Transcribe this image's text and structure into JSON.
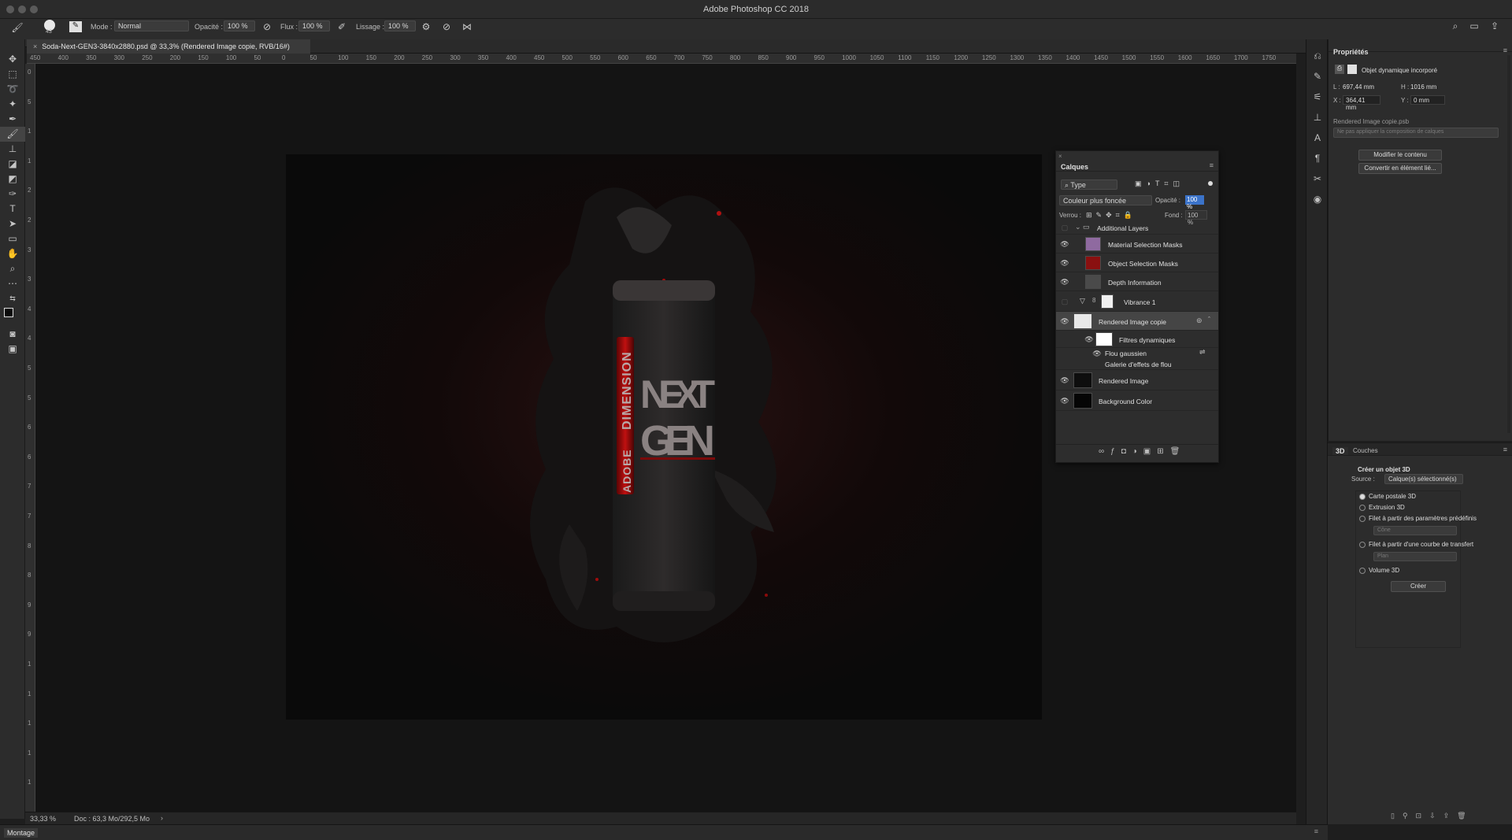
{
  "app": {
    "title": "Adobe Photoshop CC 2018"
  },
  "options_bar": {
    "brush_size": "43",
    "mode_label": "Mode :",
    "mode_value": "Normal",
    "opacity_label": "Opacité :",
    "opacity_value": "100 %",
    "flow_label": "Flux :",
    "flow_value": "100 %",
    "smoothing_label": "Lissage :",
    "smoothing_value": "100 %"
  },
  "document": {
    "tab_title": "Soda-Next-GEN3-3840x2880.psd @ 33,3% (Rendered Image copie, RVB/16#)",
    "zoom": "33,33 %",
    "doc_info": "Doc : 63,3 Mo/292,5 Mo"
  },
  "rulers": {
    "h_ticks": [
      "450",
      "400",
      "350",
      "300",
      "250",
      "200",
      "150",
      "100",
      "50",
      "0",
      "50",
      "100",
      "150",
      "200",
      "250",
      "300",
      "350",
      "400",
      "450",
      "500",
      "550",
      "600",
      "650",
      "700",
      "750",
      "800",
      "850",
      "900",
      "950",
      "1000",
      "1050",
      "1100",
      "1150",
      "1200",
      "1250",
      "1300",
      "1350",
      "1400",
      "1450",
      "1500",
      "1550",
      "1600",
      "1650",
      "1700",
      "1750"
    ],
    "v_ticks": [
      "0",
      "5",
      "1",
      "1",
      "2",
      "2",
      "3",
      "3",
      "4",
      "4",
      "5",
      "5",
      "6",
      "6",
      "7",
      "7",
      "8",
      "8",
      "9",
      "9",
      "1",
      "1",
      "1",
      "1",
      "1"
    ]
  },
  "artwork": {
    "can_text_1": "DIMENSION",
    "can_text_2": "ADOBE",
    "can_text_3": "NEXT",
    "can_text_4": "GEN"
  },
  "layers_panel": {
    "title": "Calques",
    "filter_value": "Type",
    "blend_value": "Couleur plus foncée",
    "opacity_label": "Opacité :",
    "opacity_value": "100 %",
    "lock_label": "Verrou :",
    "fill_label": "Fond :",
    "fill_value": "100 %",
    "layers": [
      {
        "name": "Additional Layers",
        "visible": false
      },
      {
        "name": "Material Selection Masks",
        "visible": true
      },
      {
        "name": "Object Selection Masks",
        "visible": true
      },
      {
        "name": "Depth Information",
        "visible": true
      },
      {
        "name": "Vibrance 1",
        "visible": false
      },
      {
        "name": "Rendered Image copie",
        "visible": true
      },
      {
        "name": "Filtres dynamiques",
        "visible": true
      },
      {
        "name": "Flou gaussien",
        "visible": true
      },
      {
        "name": "Galerie d'effets de flou",
        "visible": false
      },
      {
        "name": "Rendered Image",
        "visible": true
      },
      {
        "name": "Background Color",
        "visible": true
      }
    ]
  },
  "properties_panel": {
    "title": "Propriétés",
    "object_type": "Objet dynamique incorporé",
    "w_label": "L :",
    "w_value": "697,44 mm",
    "h_label": "H :",
    "h_value": "1016 mm",
    "x_label": "X :",
    "x_value": "364,41 mm",
    "y_label": "Y :",
    "y_value": "0 mm",
    "file_name": "Rendered Image copie.psb",
    "comp_placeholder": "Ne pas appliquer la composition de calques",
    "edit_button": "Modifier le contenu",
    "convert_button": "Convertir en élément lié..."
  },
  "threed_panel": {
    "tab_3d": "3D",
    "tab_channels": "Couches",
    "heading": "Créer un objet 3D",
    "source_label": "Source :",
    "source_value": "Calque(s) sélectionné(s)",
    "options": [
      "Carte postale 3D",
      "Extrusion 3D",
      "Filet à partir des paramètres prédéfinis",
      "Filet à partir d'une courbe de transfert",
      "Volume 3D"
    ],
    "preset_value": "Cône",
    "curve_value": "Plan",
    "create_button": "Créer"
  },
  "workspace": {
    "montage_label": "Montage"
  },
  "colors": {
    "accent": "#d21414",
    "panel": "#2c2c2c",
    "canvas": "#0b0b0b"
  }
}
